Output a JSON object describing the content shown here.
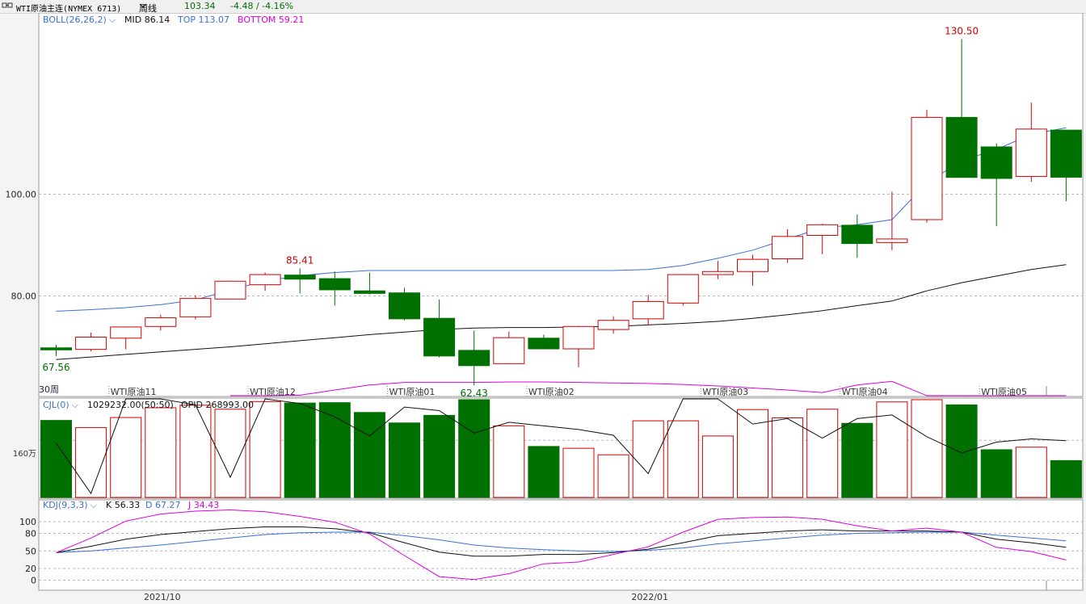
{
  "header": {
    "icon": "link-icon",
    "symbol": "WTI原油主连(NYMEX 6713)",
    "period": "周线",
    "price": "103.34",
    "change": "-4.48 / -4.16%"
  },
  "colors": {
    "up": "#d40000",
    "down": "#007000",
    "mid": "#111111",
    "top": "#3a6fd8",
    "bottom": "#dd00dd",
    "k": "#111111",
    "d": "#3a6fd8",
    "j": "#dd00dd"
  },
  "chart_data": [
    {
      "type": "candlestick",
      "legend": {
        "name": "BOLL(26,26,2)",
        "mid": "MID 86.14",
        "top": "TOP 113.07",
        "bottom": "BOTTOM 59.21"
      },
      "period_label": "30周",
      "ylim": [
        61,
        135
      ],
      "yticks": [
        80,
        100
      ],
      "ytick_labels": [
        "80.00",
        "100.00"
      ],
      "annotations": [
        {
          "index": 7,
          "value": 85.41,
          "label": "85.41",
          "pos": "above",
          "color": "up"
        },
        {
          "index": 26,
          "value": 130.5,
          "label": "130.50",
          "pos": "above",
          "color": "up"
        },
        {
          "index": 0,
          "value": 67.56,
          "label": "67.56",
          "pos": "below",
          "color": "down"
        },
        {
          "index": 12,
          "value": 62.43,
          "label": "62.43",
          "pos": "below",
          "color": "down"
        }
      ],
      "contract_labels": [
        {
          "index": 2,
          "label": "WTI原油11"
        },
        {
          "index": 6,
          "label": "WTI原油12"
        },
        {
          "index": 10,
          "label": "WTI原油01"
        },
        {
          "index": 14,
          "label": "WTI原油02"
        },
        {
          "index": 19,
          "label": "WTI原油03"
        },
        {
          "index": 23,
          "label": "WTI原油04"
        },
        {
          "index": 27,
          "label": "WTI原油05"
        }
      ],
      "ohlc": [
        [
          69.8,
          70.4,
          68.2,
          69.4
        ],
        [
          69.5,
          72.8,
          69.1,
          71.9
        ],
        [
          71.7,
          74.0,
          69.5,
          73.9
        ],
        [
          74.0,
          76.3,
          73.2,
          75.7
        ],
        [
          75.9,
          80.1,
          75.4,
          79.5
        ],
        [
          79.4,
          83.0,
          79.4,
          82.9
        ],
        [
          82.2,
          84.6,
          81.0,
          84.2
        ],
        [
          84.1,
          85.41,
          80.5,
          83.3
        ],
        [
          83.4,
          84.8,
          78.1,
          81.2
        ],
        [
          81.0,
          84.6,
          80.3,
          80.5
        ],
        [
          80.6,
          81.6,
          75.2,
          75.5
        ],
        [
          75.6,
          79.3,
          67.9,
          68.2
        ],
        [
          69.3,
          73.2,
          62.43,
          66.3
        ],
        [
          66.7,
          73.0,
          66.6,
          71.8
        ],
        [
          71.7,
          72.4,
          69.8,
          69.6
        ],
        [
          69.6,
          74.1,
          66.0,
          74.0
        ],
        [
          73.4,
          76.0,
          72.6,
          75.2
        ],
        [
          75.5,
          80.2,
          74.3,
          78.9
        ],
        [
          78.6,
          84.3,
          78.1,
          84.2
        ],
        [
          84.2,
          86.9,
          83.3,
          84.8
        ],
        [
          84.8,
          88.1,
          82.0,
          87.2
        ],
        [
          87.3,
          93.1,
          86.5,
          91.7
        ],
        [
          91.9,
          94.2,
          88.2,
          94.0
        ],
        [
          93.9,
          96.0,
          87.5,
          90.3
        ],
        [
          90.5,
          100.5,
          89.0,
          91.2
        ],
        [
          95.0,
          116.6,
          94.4,
          115.1
        ],
        [
          115.1,
          130.5,
          103.5,
          103.3
        ],
        [
          109.3,
          110.0,
          93.7,
          103.1
        ],
        [
          103.5,
          118.0,
          102.4,
          112.8
        ],
        [
          112.6,
          112.6,
          98.6,
          103.34
        ]
      ],
      "mid_line": [
        67.5,
        68.0,
        68.5,
        69.0,
        69.5,
        70.0,
        70.6,
        71.2,
        71.8,
        72.4,
        72.9,
        73.4,
        73.7,
        73.8,
        73.8,
        73.9,
        74.0,
        74.3,
        74.6,
        75.0,
        75.6,
        76.3,
        77.1,
        78.1,
        79.0,
        81.0,
        82.6,
        83.9,
        85.2,
        86.14
      ],
      "top_line": [
        77.0,
        77.3,
        77.7,
        78.3,
        79.2,
        81.2,
        82.9,
        84.0,
        84.6,
        85.0,
        85.0,
        85.0,
        85.0,
        85.0,
        85.0,
        85.0,
        85.0,
        85.2,
        86.0,
        87.4,
        89.0,
        91.2,
        93.4,
        94.0,
        95.0,
        102.2,
        106.6,
        108.8,
        111.8,
        113.07
      ],
      "bottom_line": [
        null,
        null,
        null,
        null,
        null,
        56.5,
        58.5,
        60.5,
        61.5,
        62.5,
        63.0,
        63.0,
        63.0,
        63.1,
        63.1,
        63.0,
        62.9,
        62.8,
        62.6,
        62.3,
        61.9,
        61.5,
        61.0,
        62.5,
        63.2,
        58.5,
        57.0,
        57.0,
        58.0,
        59.21
      ]
    },
    {
      "type": "bar",
      "legend": {
        "name": "CJL(0)",
        "cjl": "1029232.00(50:50)",
        "opid": "OPID 268993.00"
      },
      "ytick_label": "160万",
      "ytick_value": 1600000,
      "ylim": [
        0,
        2700000
      ],
      "volume": [
        2150000,
        1950000,
        2230000,
        2500000,
        2570000,
        2460000,
        2670000,
        2630000,
        2640000,
        2370000,
        2080000,
        2290000,
        2950000,
        2000000,
        1430000,
        1380000,
        1200000,
        2140000,
        2140000,
        1720000,
        2450000,
        2220000,
        2460000,
        2070000,
        2660000,
        2850000,
        2580000,
        1340000,
        1410000,
        1040000
      ],
      "opid_line": [
        1520000,
        130000,
        2980000,
        2830000,
        2580000,
        580000,
        2930000,
        2620000,
        2250000,
        1720000,
        2520000,
        2420000,
        1800000,
        2100000,
        2000000,
        1900000,
        1740000,
        680000,
        2900000,
        2780000,
        2050000,
        2200000,
        1660000,
        2200000,
        2300000,
        1700000,
        1250000,
        1550000,
        1640000,
        1590000
      ]
    },
    {
      "type": "line",
      "legend": {
        "name": "KDJ(9,3,3)",
        "k": "K 56.33",
        "d": "D 67.27",
        "j": "J 34.43"
      },
      "ylim": [
        -10,
        110
      ],
      "yticks": [
        0,
        20,
        50,
        80,
        100
      ],
      "k": [
        47,
        58,
        70,
        78,
        83,
        88,
        91,
        91,
        88,
        81,
        64,
        48,
        41,
        41,
        44,
        44,
        47,
        53,
        64,
        76,
        80,
        84,
        86,
        84,
        84,
        84,
        82,
        70,
        64,
        56.33
      ],
      "d": [
        47,
        50,
        55,
        60,
        66,
        72,
        78,
        81,
        82,
        82,
        76,
        69,
        60,
        55,
        52,
        50,
        49,
        51,
        55,
        62,
        67,
        72,
        77,
        80,
        81,
        82,
        82,
        77,
        72,
        67.27
      ],
      "j": [
        47,
        72,
        101,
        113,
        118,
        120,
        117,
        109,
        99,
        79,
        42,
        6,
        1,
        11,
        28,
        31,
        44,
        57,
        82,
        104,
        107,
        108,
        104,
        93,
        84,
        89,
        82,
        56,
        49,
        34.43
      ]
    }
  ],
  "xaxis": {
    "labels": [
      {
        "index": 3,
        "label": "2021/10"
      },
      {
        "index": 17,
        "label": "2022/01"
      }
    ]
  }
}
